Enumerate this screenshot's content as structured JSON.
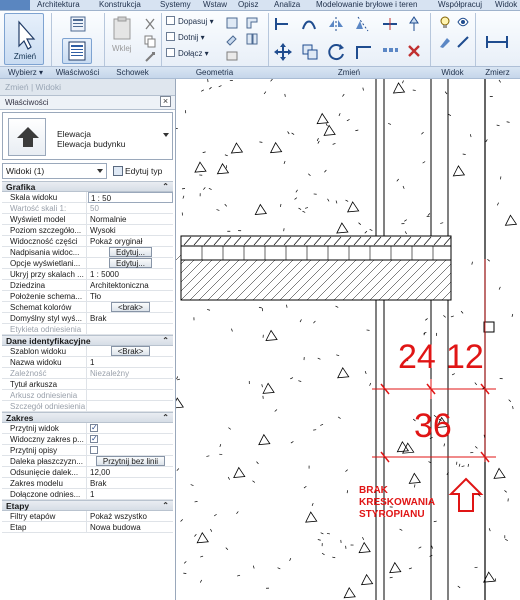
{
  "ribbon": {
    "tabs": [
      "Architektura",
      "Konstrukcja",
      "Systemy",
      "Wstaw",
      "Opisz",
      "Analiza",
      "Modelowanie bryłowe i teren",
      "Współpracuj",
      "Widok"
    ],
    "panels": {
      "select": "Wybierz",
      "properties": "Właściwości",
      "clipboard": "Schowek",
      "geometry": "Geometria",
      "modify": "Zmień",
      "view": "Widok",
      "measure": "Zmierz"
    },
    "modify_button": "Zmień",
    "paste_button": "Wklej",
    "geometry_tools": {
      "cope": "Dopasuj",
      "cut": "Dotnij",
      "join": "Dołącz"
    }
  },
  "options_bar": "Zmień | Widoki",
  "properties": {
    "title": "Właściwości",
    "type_name_1": "Elewacja",
    "type_name_2": "Elewacja budynku",
    "instance_selector": "Widoki (1)",
    "edit_type": "Edytuj typ",
    "groups": [
      {
        "name": "Grafika",
        "rows": [
          {
            "name": "Skala widoku",
            "value": "1 : 50",
            "style": "boxed"
          },
          {
            "name": "Wartość skali 1:",
            "value": "50",
            "style": "dim"
          },
          {
            "name": "Wyświetl model",
            "value": "Normalnie"
          },
          {
            "name": "Poziom szczegóło...",
            "value": "Wysoki"
          },
          {
            "name": "Widoczność części",
            "value": "Pokaż oryginał"
          },
          {
            "name": "Nadpisania widoc...",
            "value": "Edytuj...",
            "style": "btn"
          },
          {
            "name": "Opcje wyświetlani...",
            "value": "Edytuj...",
            "style": "btn"
          },
          {
            "name": "Ukryj przy skalach ...",
            "value": "1 : 5000"
          },
          {
            "name": "Dziedzina",
            "value": "Architektoniczna"
          },
          {
            "name": "Położenie schema...",
            "value": "Tło"
          },
          {
            "name": "Schemat kolorów",
            "value": "<brak>",
            "style": "btn"
          },
          {
            "name": "Domyślny styl wyś...",
            "value": "Brak"
          },
          {
            "name": "Etykieta odniesienia",
            "value": "",
            "style": "dim"
          }
        ]
      },
      {
        "name": "Dane identyfikacyjne",
        "rows": [
          {
            "name": "Szablon widoku",
            "value": "<Brak>",
            "style": "btn"
          },
          {
            "name": "Nazwa widoku",
            "value": "1"
          },
          {
            "name": "Zależność",
            "value": "Niezależny",
            "style": "dim"
          },
          {
            "name": "Tytuł arkusza",
            "value": ""
          },
          {
            "name": "Arkusz odniesienia",
            "value": "",
            "style": "dim"
          },
          {
            "name": "Szczegół odniesienia",
            "value": "",
            "style": "dim"
          }
        ]
      },
      {
        "name": "Zakres",
        "rows": [
          {
            "name": "Przytnij widok",
            "value": "",
            "style": "check-on"
          },
          {
            "name": "Widoczny zakres p...",
            "value": "",
            "style": "check-on"
          },
          {
            "name": "Przytnij opisy",
            "value": "",
            "style": "check-off"
          },
          {
            "name": "Daleka płaszczyzn...",
            "value": "Przytnij bez linii",
            "style": "btn"
          },
          {
            "name": "Odsunięcie dalek...",
            "value": "12,00"
          },
          {
            "name": "Zakres modelu",
            "value": "Brak"
          },
          {
            "name": "Dołączone odnies...",
            "value": "1"
          }
        ]
      },
      {
        "name": "Etapy",
        "rows": [
          {
            "name": "Filtry etapów",
            "value": "Pokaż wszystko"
          },
          {
            "name": "Etap",
            "value": "Nowa budowa"
          }
        ]
      }
    ]
  },
  "drawing": {
    "dim_24": "24",
    "dim_12": "12",
    "dim_36": "36",
    "note_line1": "BRAK",
    "note_line2": "KRESKOWANIA",
    "note_line3": "STYROPIANU",
    "annotation_color": "#e01515"
  }
}
